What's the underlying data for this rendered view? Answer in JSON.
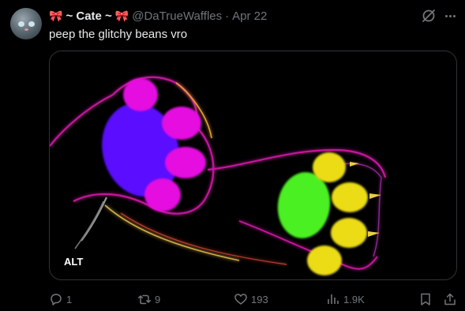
{
  "author": {
    "ribbon_left": "🎀",
    "display_name": "~ Cate ~",
    "ribbon_right": "🎀",
    "handle": "@DaTrueWaffles",
    "separator": "·",
    "date": "Apr 22"
  },
  "tweet": {
    "text": "peep the glitchy beans vro"
  },
  "media": {
    "alt_badge": "ALT"
  },
  "actions": {
    "replies": "1",
    "reposts": "9",
    "likes": "193",
    "views": "1.9K"
  },
  "icons": [
    "grok-icon",
    "more-icon",
    "reply-icon",
    "repost-icon",
    "like-icon",
    "views-icon",
    "bookmark-icon",
    "share-icon"
  ],
  "colors": {
    "background": "#000000",
    "text": "#e7e9ea",
    "muted": "#71767b",
    "border": "#2f3336"
  }
}
